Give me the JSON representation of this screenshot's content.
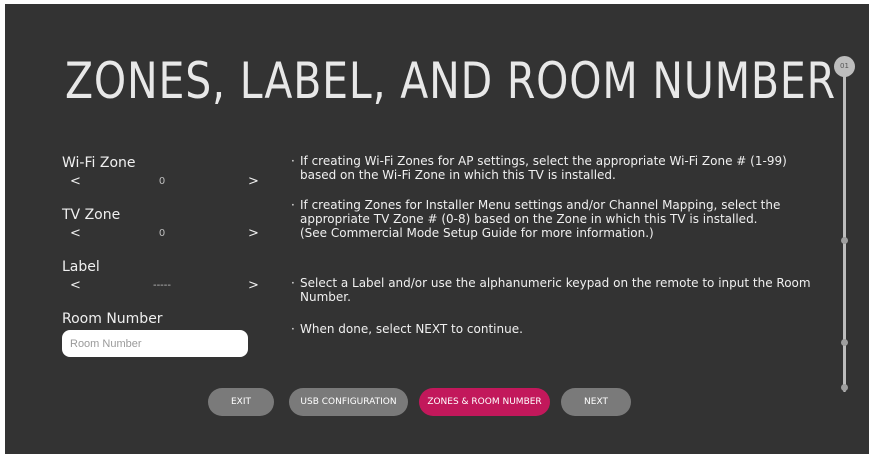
{
  "title": "ZONES, LABEL, AND ROOM NUMBER",
  "settings": {
    "wifi_zone": {
      "label": "Wi-Fi Zone",
      "value": "0",
      "prev": "<",
      "next": ">"
    },
    "tv_zone": {
      "label": "TV Zone",
      "value": "0",
      "prev": "<",
      "next": ">"
    },
    "label": {
      "label": "Label",
      "value": "-----",
      "prev": "<",
      "next": ">"
    },
    "room_number": {
      "label": "Room Number",
      "placeholder": "Room Number",
      "value": ""
    }
  },
  "instructions": {
    "bullet": "·",
    "items": [
      "If creating Wi-Fi Zones for AP settings, select the appropriate Wi-Fi Zone # (1-99) based on the Wi-Fi Zone in which this TV is installed.",
      "If creating Zones for Installer Menu settings and/or Channel Mapping, select the appropriate TV Zone # (0-8) based on the Zone in which this TV is installed.",
      "(See Commercial Mode Setup Guide for more information.)",
      "Select a Label and/or use the alphanumeric keypad on the remote to input the Room Number.",
      "When done, select NEXT to continue."
    ]
  },
  "buttons": {
    "exit": "EXIT",
    "usb_configuration": "USB CONFIGURATION",
    "zones_room_number": "ZONES & ROOM NUMBER",
    "next": "NEXT"
  },
  "scroll": {
    "step_label": "01"
  },
  "colors": {
    "background": "#333333",
    "accent": "#c2185b",
    "button_grey": "#7a7a7a",
    "text": "#f0f0f0"
  }
}
